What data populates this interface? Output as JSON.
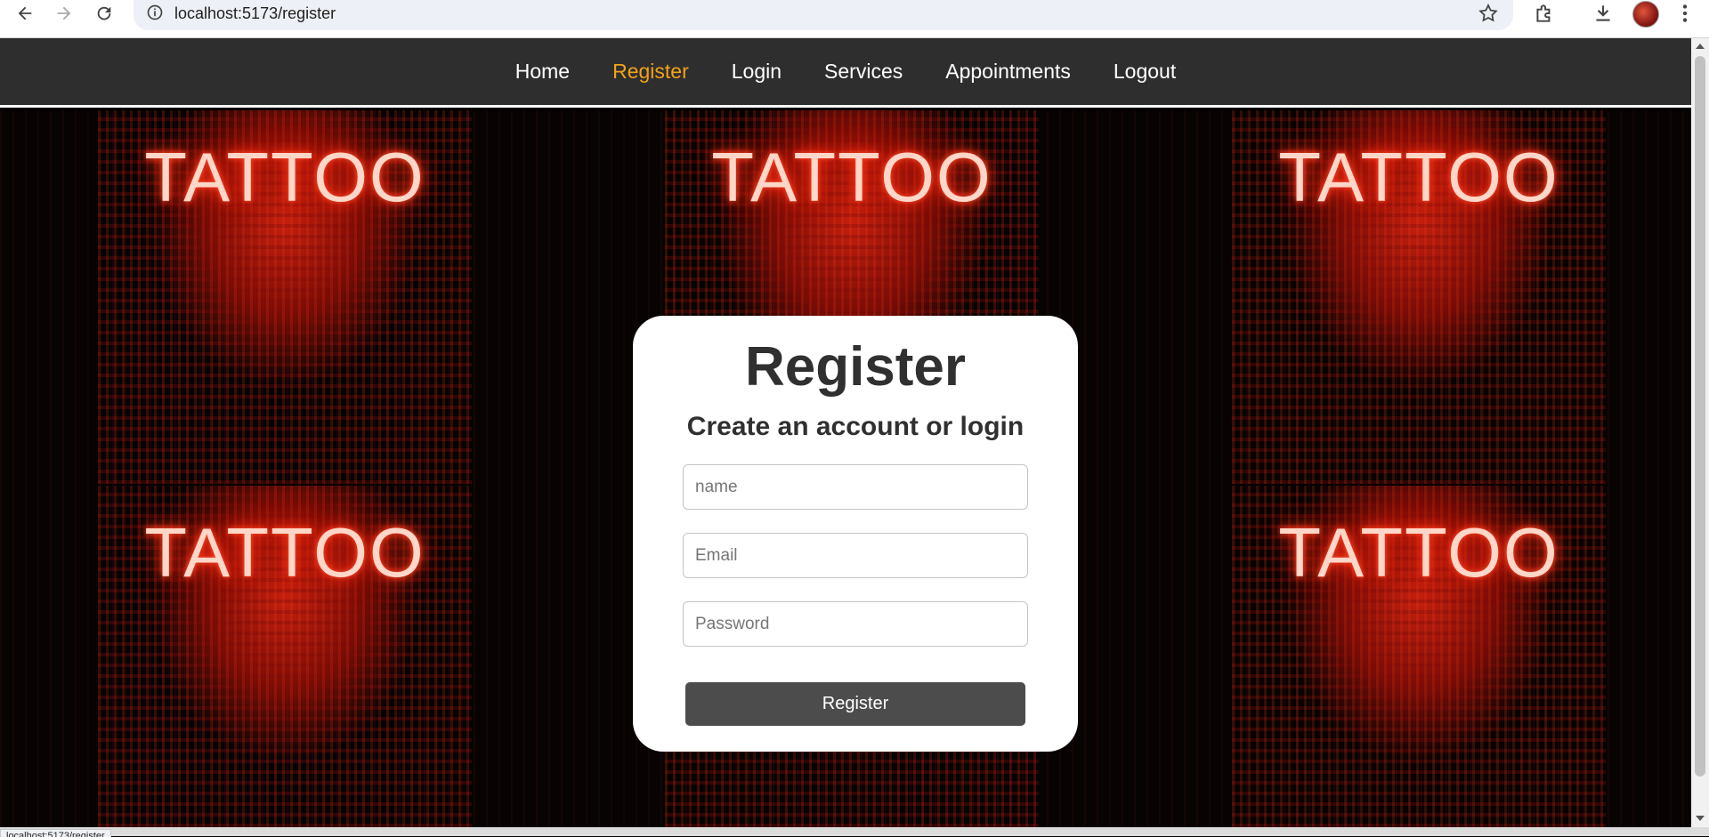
{
  "browser": {
    "url": "localhost:5173/register",
    "status_url": "localhost:5173/register",
    "icons": [
      "back-arrow-icon",
      "forward-arrow-icon",
      "reload-icon",
      "site-info-icon",
      "star-icon",
      "extensions-icon",
      "download-icon",
      "kebab-menu-icon"
    ]
  },
  "nav": {
    "items": [
      "Home",
      "Register",
      "Login",
      "Services",
      "Appointments",
      "Logout"
    ],
    "active": "Register",
    "active_color": "#f2a21a",
    "background": "#2e2e2e"
  },
  "hero": {
    "neon_text": "TATTOO"
  },
  "form": {
    "title": "Register",
    "subtitle": "Create an account or login",
    "name_placeholder": "name",
    "email_placeholder": "Email",
    "password_placeholder": "Password",
    "submit_label": "Register",
    "button_color": "#4c4c4c"
  }
}
